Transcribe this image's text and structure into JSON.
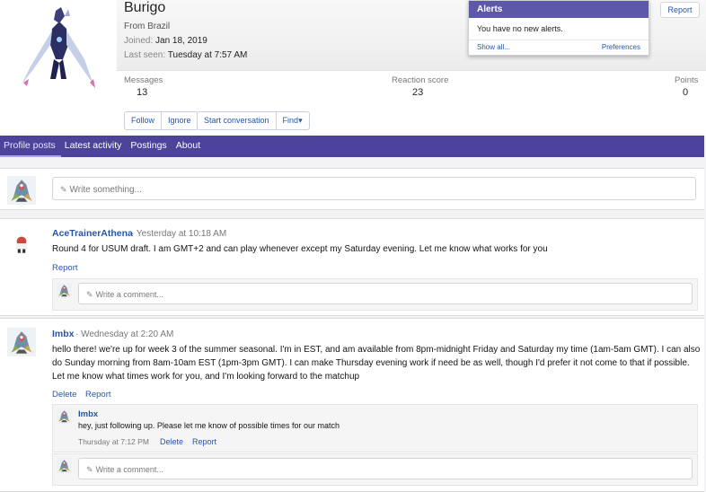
{
  "profile": {
    "username": "Burigo",
    "from": "From Brazil",
    "joined_label": "Joined:",
    "joined_value": "Jan 18, 2019",
    "last_seen_label": "Last seen:",
    "last_seen_value": "Tuesday at 7:57 AM",
    "stats": [
      {
        "label": "Messages",
        "value": "13"
      },
      {
        "label": "Reaction score",
        "value": "23"
      },
      {
        "label": "Points",
        "value": "0"
      }
    ],
    "actions_a": [
      "Follow",
      "Ignore"
    ],
    "actions_b": [
      "Start conversation",
      "Find"
    ],
    "find_caret": "▾",
    "report": "Report"
  },
  "alerts": {
    "title": "Alerts",
    "empty": "You have no new alerts.",
    "show_all": "Show all...",
    "preferences": "Preferences"
  },
  "tabs": [
    "Profile posts",
    "Latest activity",
    "Postings",
    "About"
  ],
  "compose": {
    "placeholder": "Write something..."
  },
  "posts": [
    {
      "author": "AceTrainerAthena",
      "time": "· Yesterday at 10:18 AM",
      "text": "Round 4 for USUM draft. I am GMT+2 and can play whenever except my Saturday evening. Let me know what works for you",
      "actions": [
        "Report"
      ],
      "comment_placeholder": "Write a comment..."
    },
    {
      "author": "Imbx",
      "time": "· Wednesday at 2:20 AM",
      "text_lines": [
        "hello there! we're up for week 3 of the summer seasonal. I'm in EST, and am available from 8pm-midnight Friday and Saturday my time (1am-5am GMT). I can also",
        "do Sunday morning from 8am-10am EST (1pm-3pm GMT). I can make Thursday evening work if need be as well, though I'd prefer it not come to that if possible.",
        "Let me know what times work for you, and I'm looking forward to the matchup"
      ],
      "actions": [
        "Delete",
        "Report"
      ],
      "comment": {
        "author": "Imbx",
        "text": "hey, just following up. Please let me know of possible times for our match",
        "time": "Thursday at 7:12 PM",
        "actions": [
          "Delete",
          "Report"
        ]
      },
      "comment_placeholder": "Write a comment..."
    }
  ],
  "colors": {
    "nav": "#4c449a",
    "alerts_head": "#5e58a8",
    "link": "#2556a6"
  }
}
